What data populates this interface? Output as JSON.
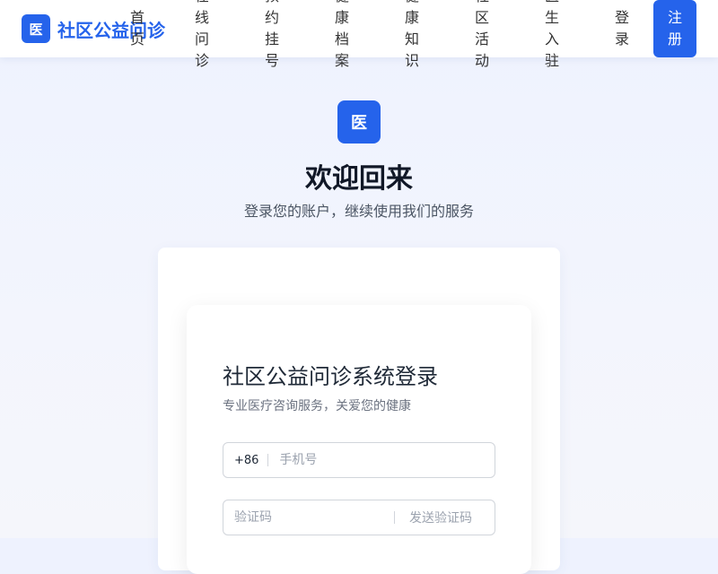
{
  "brand": {
    "logo_char": "医",
    "name": "社区公益问诊"
  },
  "nav": {
    "items": [
      "首页",
      "在线问诊",
      "预约挂号",
      "健康档案",
      "健康知识",
      "社区活动",
      "医生入驻"
    ],
    "login": "登录",
    "register": "注册"
  },
  "hero": {
    "logo_char": "医",
    "title": "欢迎回来",
    "subtitle": "登录您的账户，继续使用我们的服务"
  },
  "form": {
    "title": "社区公益问诊系统登录",
    "subtitle": "专业医疗咨询服务，关爱您的健康",
    "phone_prefix": "+86",
    "phone_placeholder": "手机号",
    "code_placeholder": "验证码",
    "send_code": "发送验证码"
  },
  "colors": {
    "accent": "#2563eb"
  }
}
